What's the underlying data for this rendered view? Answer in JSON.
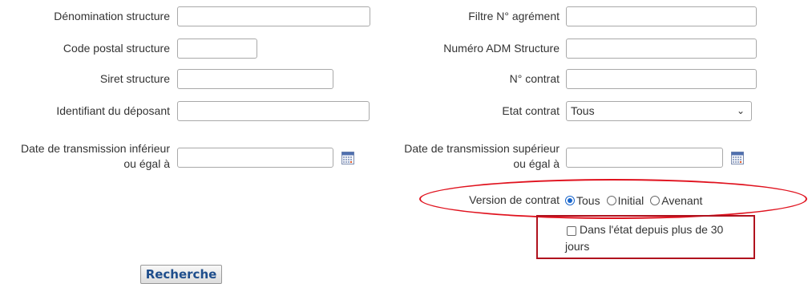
{
  "form": {
    "denomination_label": "Dénomination structure",
    "denomination_value": "",
    "code_postal_label": "Code postal structure",
    "code_postal_value": "",
    "siret_label": "Siret structure",
    "siret_value": "",
    "identifiant_label": "Identifiant du déposant",
    "identifiant_value": "",
    "date_inf_label_1": "Date de transmission inférieur",
    "date_inf_label_2": "ou égal à",
    "date_inf_value": "",
    "filtre_label": "Filtre N° agrément",
    "filtre_value": "",
    "numero_adm_label": "Numéro ADM Structure",
    "numero_adm_value": "",
    "contrat_label": "N° contrat",
    "contrat_value": "",
    "etat_label": "Etat contrat",
    "etat_selected": "Tous",
    "date_sup_label_1": "Date de transmission supérieur",
    "date_sup_label_2": "ou égal à",
    "date_sup_value": "",
    "version_label": "Version de contrat",
    "version_options": [
      "Tous",
      "Initial",
      "Avenant"
    ],
    "version_selected": "Tous",
    "checkbox_label_1": "Dans l'état depuis plus de 30",
    "checkbox_label_2": "jours",
    "checkbox_checked": false,
    "submit_label": "Recherche"
  },
  "icons": {
    "date_picker": "calendar-icon",
    "select_arrow": "chevron-down-icon"
  },
  "colors": {
    "highlight_red": "#e0121e",
    "highlight_dark_red": "#b0121e",
    "radio_selected": "#1a66cc",
    "button_text": "#1f4e8c"
  }
}
